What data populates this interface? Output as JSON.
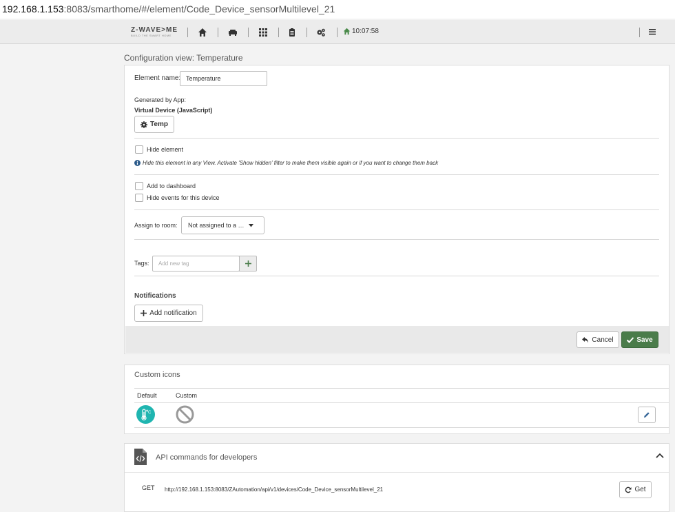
{
  "browser": {
    "url_host": "192.168.1.153",
    "url_rest": ":8083/smarthome/#/element/Code_Device_sensorMultilevel_21"
  },
  "navbar": {
    "logo_text": "Z-WAVE>ME",
    "logo_sub": "BUILD THE SMART HOME",
    "clock": "10:07:58"
  },
  "breadcrumb": "Configuration view: Temperature",
  "form": {
    "element_name_label": "Element name:",
    "element_name_value": "Temperature",
    "generated_by_label": "Generated by App:",
    "generated_by_value": "Virtual Device (JavaScript)",
    "app_button_label": "Temp",
    "hide_element_label": "Hide element",
    "hide_element_info": "Hide this element in any View. Activate 'Show hidden' filter to make them visible again or if you want to change them back",
    "add_dashboard_label": "Add to dashboard",
    "hide_events_label": "Hide events for this device",
    "assign_room_label": "Assign to room:",
    "assign_room_value": "Not assigned to a …",
    "tags_label": "Tags:",
    "tags_placeholder": "Add new tag",
    "notifications_title": "Notifications",
    "add_notification_label": "Add notification",
    "cancel_label": "Cancel",
    "save_label": "Save"
  },
  "custom_icons": {
    "title": "Custom icons",
    "col_default": "Default",
    "col_custom": "Custom"
  },
  "api": {
    "title": "API commands for developers",
    "method": "GET",
    "url": "http://192.168.1.153:8083/ZAutomation/api/v1/devices/Code_Device_sensorMultilevel_21",
    "get_label": "Get"
  },
  "colors": {
    "save_green": "#4a7c4a",
    "icon_teal": "#1fb5b0",
    "nav_green": "#4a8a4a"
  }
}
